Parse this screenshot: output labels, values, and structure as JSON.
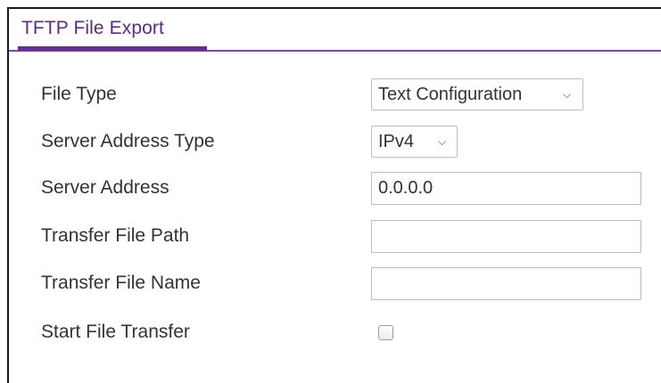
{
  "panel": {
    "title": "TFTP File Export"
  },
  "form": {
    "file_type": {
      "label": "File Type",
      "selected": "Text Configuration"
    },
    "server_address_type": {
      "label": "Server Address Type",
      "selected": "IPv4"
    },
    "server_address": {
      "label": "Server Address",
      "value": "0.0.0.0"
    },
    "transfer_file_path": {
      "label": "Transfer File Path",
      "value": ""
    },
    "transfer_file_name": {
      "label": "Transfer File Name",
      "value": ""
    },
    "start_file_transfer": {
      "label": "Start File Transfer",
      "checked": false
    }
  },
  "colors": {
    "accent": "#6a2c91",
    "title_text": "#5a2d82",
    "label_text": "#333333"
  },
  "icons": {
    "dropdown": "chevron-down-icon"
  }
}
